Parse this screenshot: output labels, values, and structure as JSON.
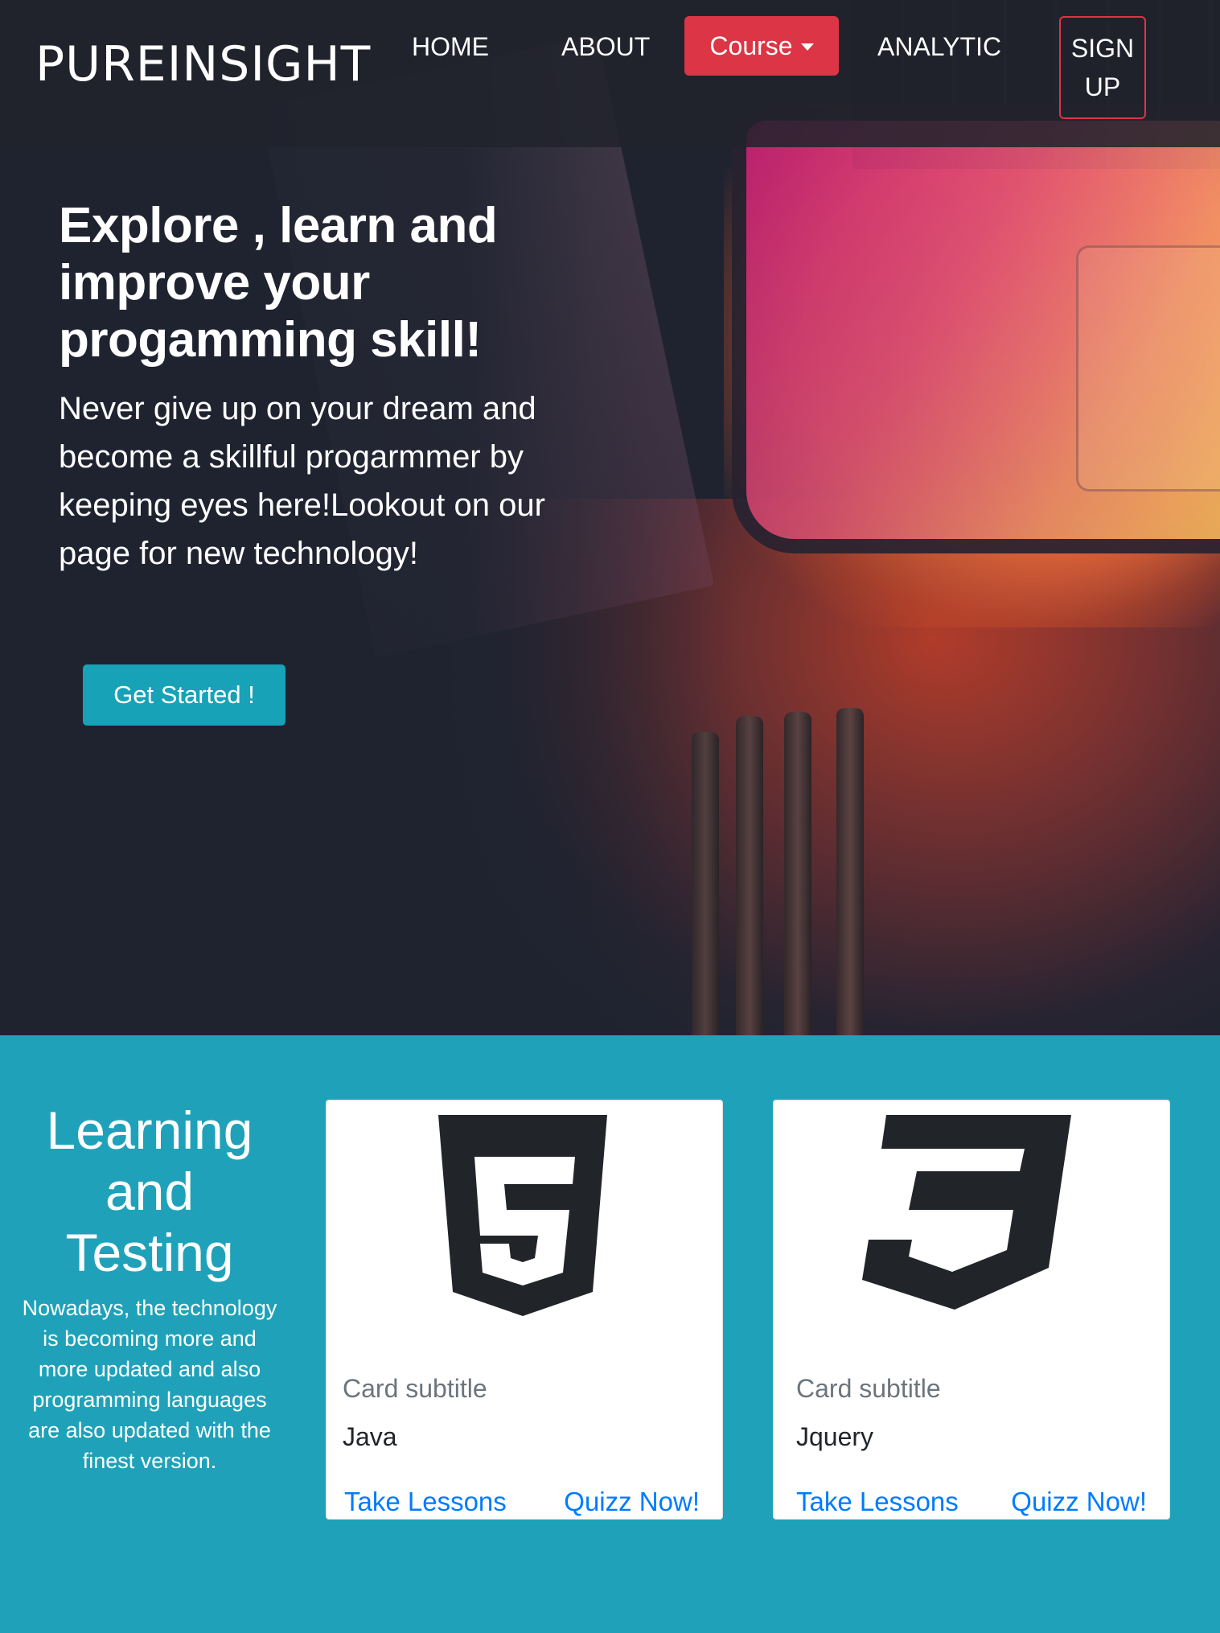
{
  "nav": {
    "brand": "PUREINSIGHT",
    "home": "HOME",
    "about": "ABOUT",
    "course": "Course",
    "analytic": "ANALYTIC",
    "signup_line1": "SIGN",
    "signup_line2": "UP"
  },
  "hero": {
    "title": "Explore , learn and improve your progamming skill!",
    "subtitle": "Never give up on your dream and become a skillful progarmmer by keeping eyes here!Lookout on our page for new technology!",
    "cta": "Get Started !"
  },
  "section": {
    "title_line1": "Learning",
    "title_line2": "and",
    "title_line3": "Testing",
    "text": "Nowadays, the technology is becoming more and more updated and also programming languages are also updated with the finest version."
  },
  "cards": [
    {
      "icon": "html5-icon",
      "subtitle": "Card subtitle",
      "name": "Java",
      "link_lessons": "Take Lessons",
      "link_quiz": "Quizz Now!"
    },
    {
      "icon": "css3-icon",
      "subtitle": "Card subtitle",
      "name": "Jquery",
      "link_lessons": "Take Lessons",
      "link_quiz": "Quizz Now!"
    }
  ],
  "colors": {
    "accent_red": "#dc3545",
    "accent_teal": "#17a2b8",
    "section_bg": "#1fa2b9",
    "link_blue": "#007bff"
  }
}
